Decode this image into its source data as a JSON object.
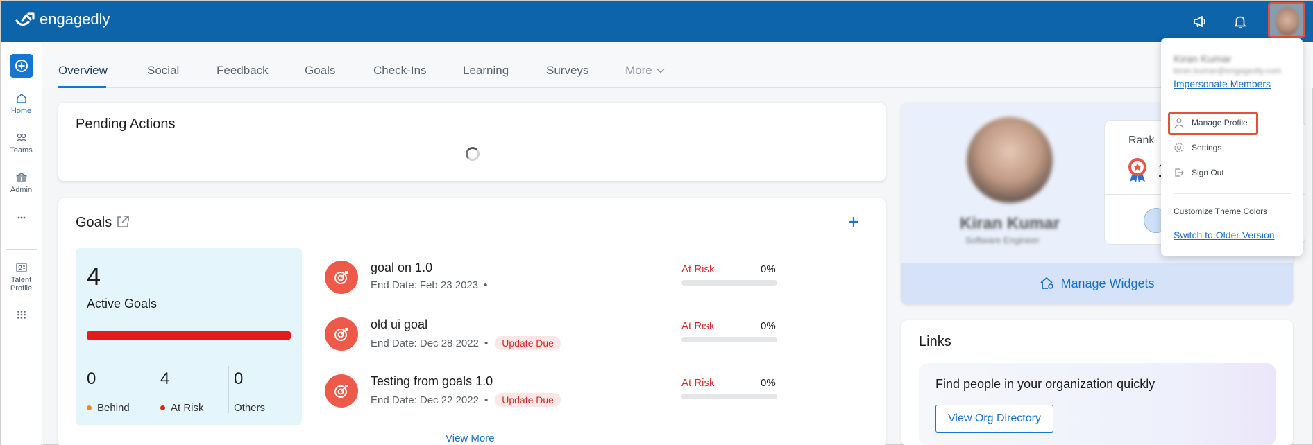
{
  "app": {
    "logo_text": "engagedly"
  },
  "colors": {
    "brand": "#0e64a8",
    "accent": "#1677d2",
    "risk": "#d62b2b",
    "goal_icon_bg": "#ee5a4a",
    "active_goals_bg": "#e4f6fc",
    "highlight": "#e2523a"
  },
  "header_icons": [
    "megaphone-icon",
    "bell-icon"
  ],
  "leftnav": {
    "add_icon": "plus-circle-icon",
    "items": [
      {
        "label": "Home",
        "icon": "home-icon"
      },
      {
        "label": "Teams",
        "icon": "teams-icon"
      },
      {
        "label": "Admin",
        "icon": "admin-icon"
      },
      {
        "label": "",
        "icon": "more-dots-icon"
      },
      {
        "label": "Talent Profile",
        "icon": "id-card-icon"
      },
      {
        "label": "",
        "icon": "apps-grid-icon"
      }
    ]
  },
  "tabs": [
    "Overview",
    "Social",
    "Feedback",
    "Goals",
    "Check-Ins",
    "Learning",
    "Surveys",
    "More"
  ],
  "pending": {
    "title": "Pending Actions"
  },
  "goals": {
    "title": "Goals",
    "summary": {
      "count": "4",
      "label": "Active Goals",
      "stats": [
        {
          "value": "0",
          "label": "Behind",
          "color": "#f08a1b"
        },
        {
          "value": "4",
          "label": "At Risk",
          "color": "#e31b1b"
        },
        {
          "value": "0",
          "label": "Others",
          "color": ""
        }
      ]
    },
    "items": [
      {
        "name": "goal on 1.0",
        "date": "End Date: Feb 23 2023",
        "badge": "",
        "status": "At Risk",
        "progress": "0%"
      },
      {
        "name": "old ui goal",
        "date": "End Date: Dec 28 2022",
        "badge": "Update Due",
        "status": "At Risk",
        "progress": "0%"
      },
      {
        "name": "Testing from goals 1.0",
        "date": "End Date: Dec 22 2022",
        "badge": "Update Due",
        "status": "At Risk",
        "progress": "0%"
      }
    ],
    "view_more": "View More"
  },
  "profile": {
    "name": "Kiran Kumar",
    "role": "Software Engineer",
    "rank_label": "Rank",
    "rank_value": "1",
    "manage_widgets": "Manage Widgets"
  },
  "links": {
    "title": "Links",
    "text": "Find people in your organization quickly",
    "button": "View Org Directory"
  },
  "dropdown": {
    "name": "Kiran Kumar",
    "email": "kiran.kumar@engagedly.com",
    "impersonate": "Impersonate Members",
    "manage_profile": "Manage Profile",
    "settings": "Settings",
    "sign_out": "Sign Out",
    "customize": "Customize Theme Colors",
    "switch": "Switch to Older Version"
  }
}
